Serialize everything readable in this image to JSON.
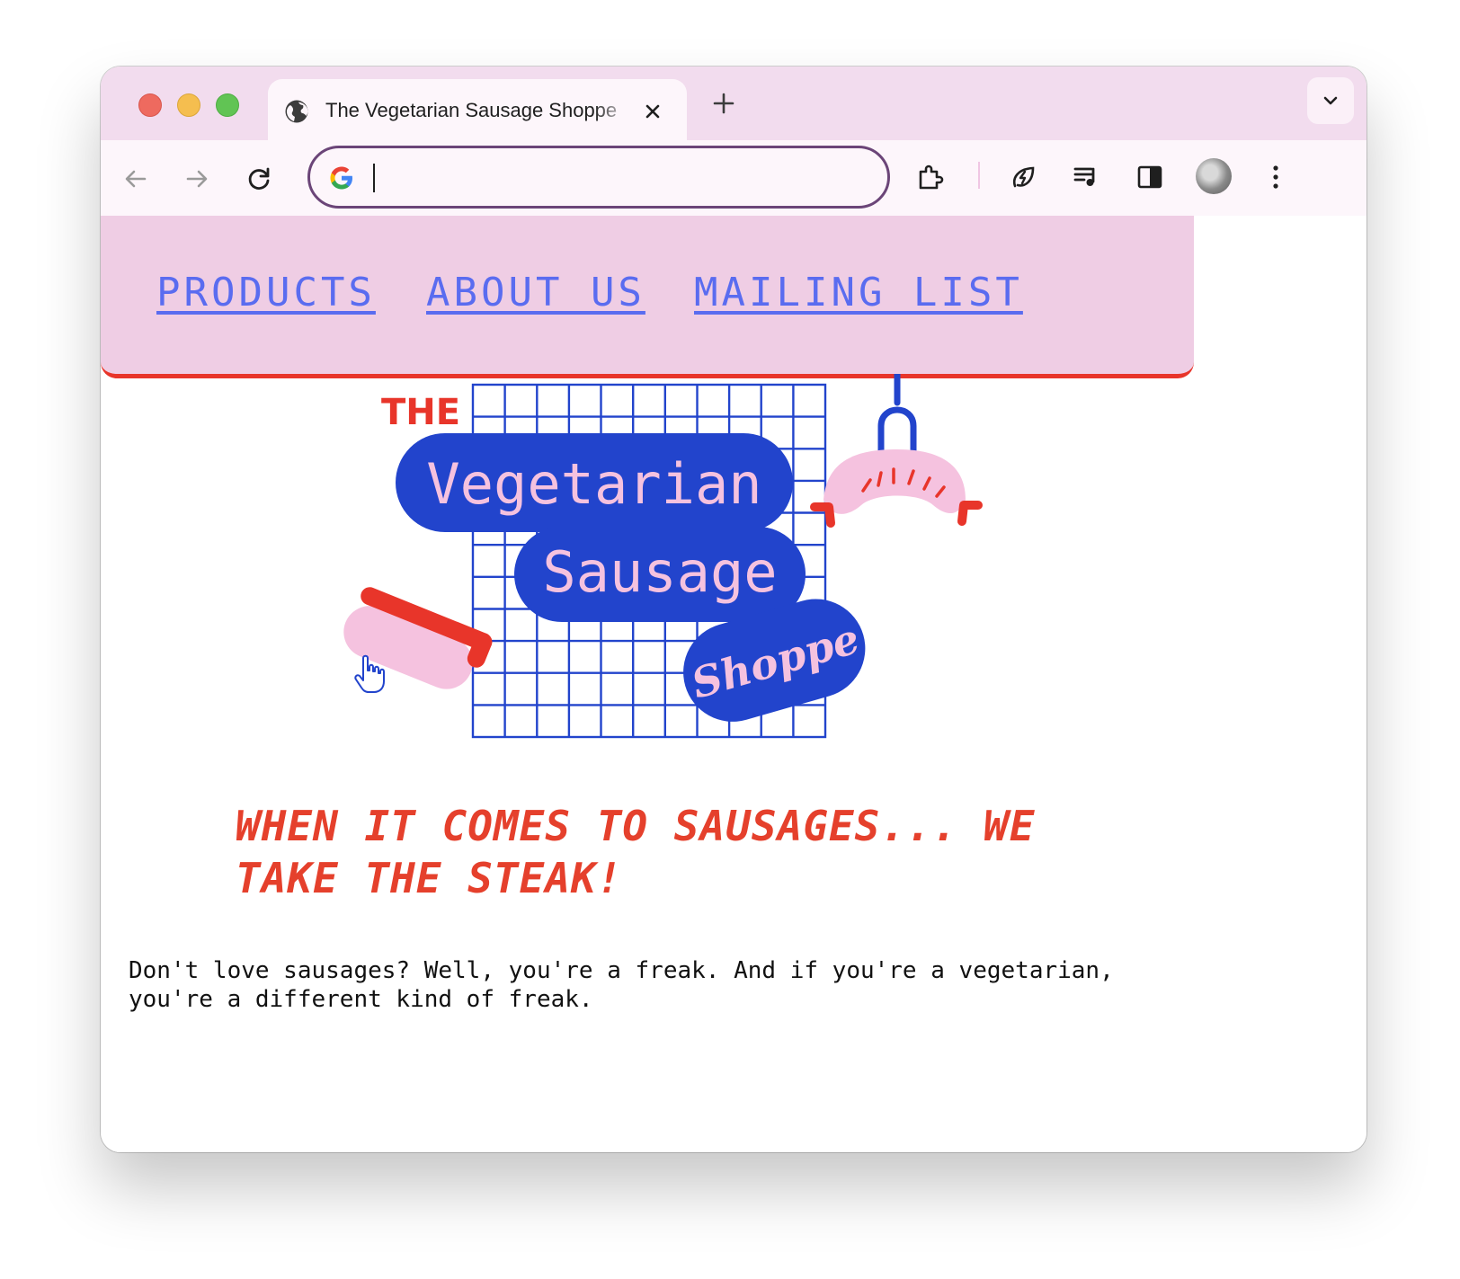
{
  "browser": {
    "tab_title": "The Vegetarian Sausage Shoppe",
    "address_value": "",
    "icons": {
      "back": "arrow-left-icon",
      "forward": "arrow-right-icon",
      "reload": "reload-icon",
      "extensions": "puzzle-icon",
      "performance": "leaf-bolt-icon",
      "media": "music-queue-icon",
      "side_panel": "side-panel-icon",
      "menu": "kebab-menu-icon"
    }
  },
  "nav": {
    "items": [
      "PRODUCTS",
      "ABOUT US",
      "MAILING LIST"
    ]
  },
  "logo": {
    "the": "THE",
    "line1": "Vegetarian",
    "line2": "Sausage",
    "line3": "Shoppe"
  },
  "hero": {
    "tagline": "WHEN IT COMES TO SAUSAGES... WE TAKE THE STEAK!",
    "body": "Don't love sausages? Well, you're a freak. And if you're a vegetarian, you're a different kind of freak."
  },
  "colors": {
    "nav_bg": "#efcde4",
    "accent_red": "#e5402c",
    "logo_blue": "#2244cc",
    "logo_pink": "#f5c2df",
    "link": "#5a6cf0"
  }
}
